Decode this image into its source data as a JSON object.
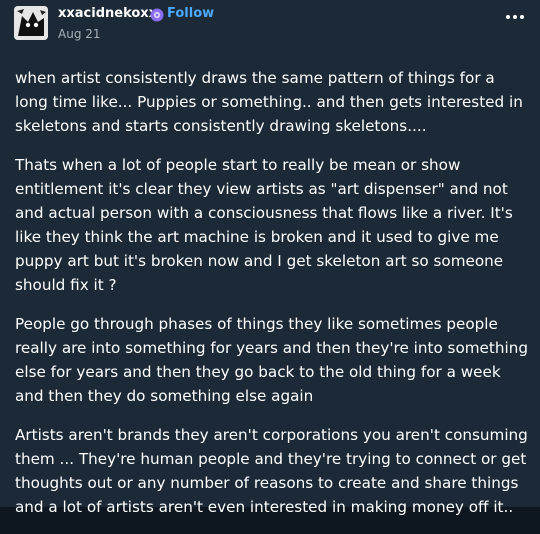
{
  "post": {
    "username": "xxacidnekoxx",
    "follow_label": "Follow",
    "date": "Aug 21",
    "paragraphs": [
      "when artist consistently draws the same pattern of things for a long time like... Puppies or something.. and then gets interested in skeletons and starts consistently drawing skeletons....",
      "Thats when a lot of people start to really be mean or show entitlement it's clear they view artists as \"art dispenser\" and not and actual person with a consciousness that flows like a river. It's like they think the art machine is broken and it used to give me puppy art but it's broken now and I get skeleton art so someone should fix it ?",
      "People go through phases of things they like sometimes people really are into something for years and then they're into something else for years and then they go back to the old thing for a week and then they do something else again",
      "Artists aren't brands they aren't corporations you aren't consuming them ... They're human people and they're trying to connect or get thoughts out or any number of reasons to create and share things and a lot of artists aren't even interested in making money off it.."
    ]
  },
  "icons": {
    "avatar": "avatar-image",
    "badge": "verified-badge-icon",
    "more": "more-options-icon"
  },
  "colors": {
    "background": "#1b2a36",
    "text": "#ffffff",
    "follow_link": "#4aa8ff",
    "date": "#a7b0b8",
    "badge": "#8a6cf0"
  }
}
